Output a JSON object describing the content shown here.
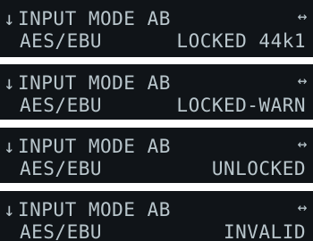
{
  "displays": [
    {
      "mode_arrow": "↓",
      "title": "INPUT MODE AB",
      "direction_icon": "↔",
      "source": "AES/EBU",
      "status": "LOCKED 44k1"
    },
    {
      "mode_arrow": "↓",
      "title": "INPUT MODE AB",
      "direction_icon": "↔",
      "source": "AES/EBU",
      "status": "LOCKED-WARN"
    },
    {
      "mode_arrow": "↓",
      "title": "INPUT MODE AB",
      "direction_icon": "↔",
      "source": "AES/EBU",
      "status": "UNLOCKED"
    },
    {
      "mode_arrow": "↓",
      "title": "INPUT MODE AB",
      "direction_icon": "↔",
      "source": "AES/EBU",
      "status": "INVALID"
    }
  ],
  "colors": {
    "lcd_background": "#101418",
    "lcd_text": "#b9c6cc"
  }
}
